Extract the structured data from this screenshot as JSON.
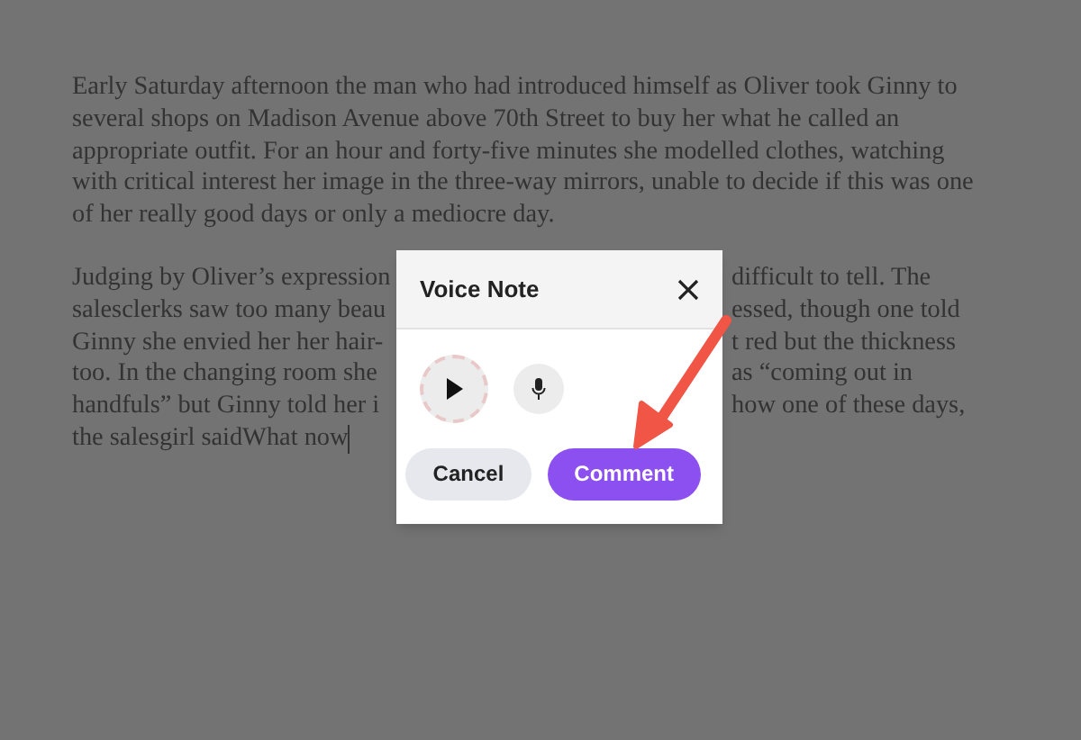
{
  "document": {
    "paragraph": "Early Saturday afternoon the man who had introduced himself as Oliver took Ginny to several shops on Madison Avenue above 70th Street to buy her what he called an appropriate outfit. For an hour and forty-five minutes she modelled clothes, watching with critical interest her image in the three-way mirrors, unable to decide if this was one of her really good days or only a mediocre day.",
    "partly_covered_lines": [
      {
        "left": "Judging by Oliver’s expression",
        "right": "difficult to tell. The"
      },
      {
        "left": "salesclerks saw too many beau",
        "right": "essed, though one told"
      },
      {
        "left": "Ginny she envied her her hair-",
        "right": "t red but the thickness"
      },
      {
        "left": "too. In the changing room she",
        "right": "as “coming out in"
      },
      {
        "left": "handfuls” but Ginny told her i",
        "right": "how one of these days,"
      },
      {
        "left": "the salesgirl saidWhat now"
      }
    ]
  },
  "dialog": {
    "title": "Voice Note",
    "cancel": "Cancel",
    "submit": "Comment"
  }
}
